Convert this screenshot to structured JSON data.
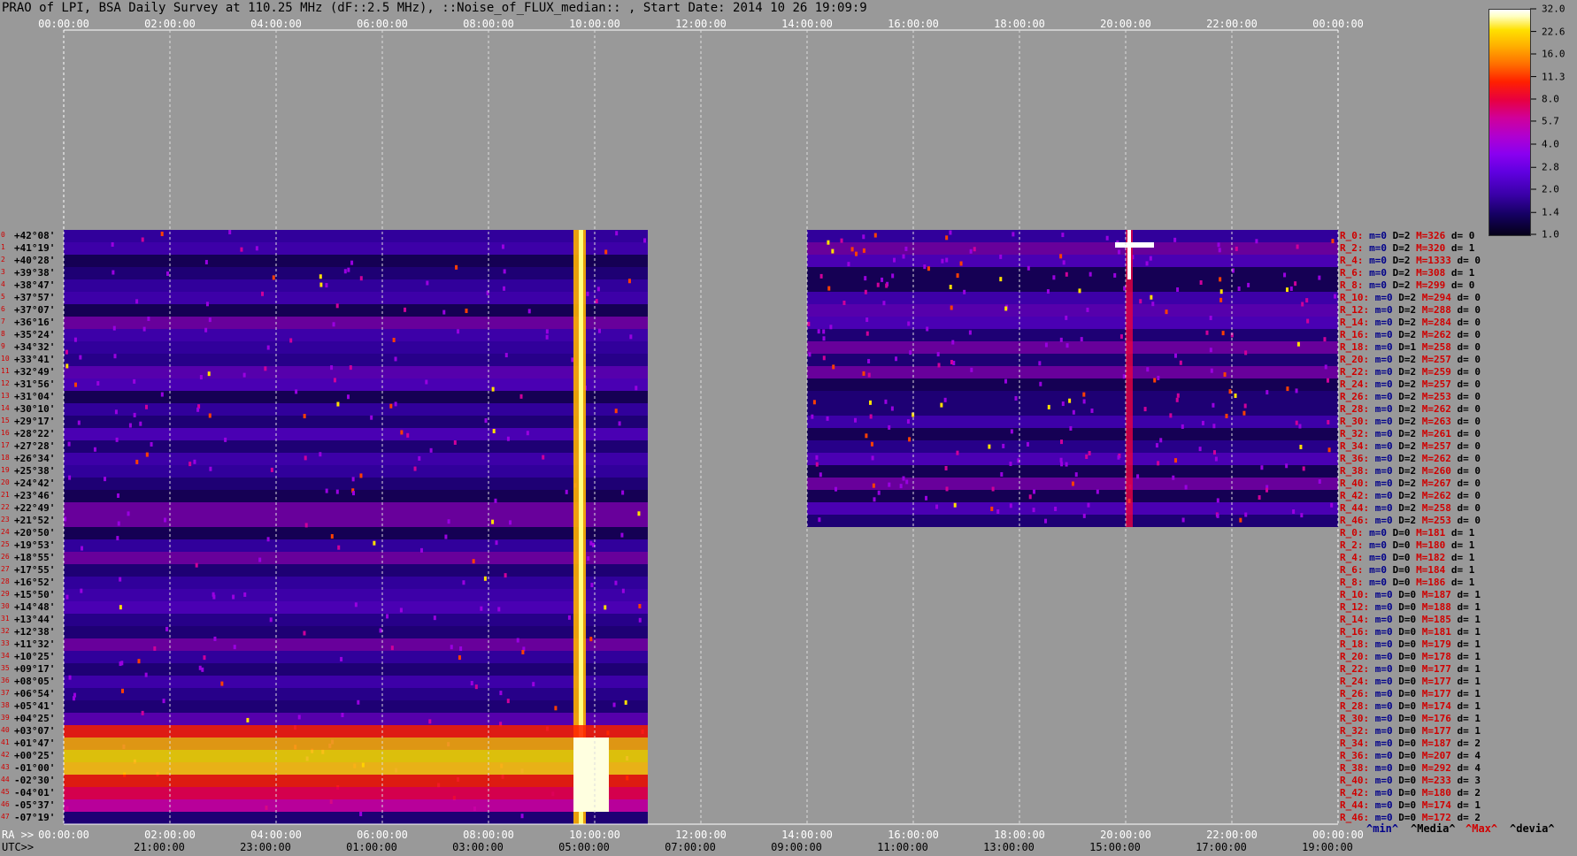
{
  "title": "PRAO of LPI, BSA Daily Survey at 110.25 MHz (dF::2.5 MHz), ::Noise_of_FLUX_median:: , Start Date: 2014 10 26 19:09:9",
  "colors": {
    "background": "#999999",
    "accent_red": "#d00000",
    "navy": "#00008a"
  },
  "axis": {
    "top_ticks": [
      "00:00:00",
      "02:00:00",
      "04:00:00",
      "06:00:00",
      "08:00:00",
      "10:00:00",
      "12:00:00",
      "14:00:00",
      "16:00:00",
      "18:00:00",
      "20:00:00",
      "22:00:00",
      "00:00:00"
    ],
    "bottom_ra_label": "RA >>",
    "bottom_ra_ticks": [
      "00:00:00",
      "02:00:00",
      "04:00:00",
      "06:00:00",
      "08:00:00",
      "10:00:00",
      "12:00:00",
      "14:00:00",
      "16:00:00",
      "18:00:00",
      "20:00:00",
      "22:00:00",
      "00:00:00"
    ],
    "bottom_utc_label": "UTC>>",
    "bottom_utc_ticks": [
      "21:00:00",
      "23:00:00",
      "01:00:00",
      "03:00:00",
      "05:00:00",
      "07:00:00",
      "09:00:00",
      "11:00:00",
      "13:00:00",
      "15:00:00",
      "17:00:00",
      "19:00:00"
    ]
  },
  "colorbar": {
    "labels": [
      "32.0",
      "22.6",
      "16.0",
      "11.3",
      "8.0",
      "5.7",
      "4.0",
      "2.8",
      "2.0",
      "1.4",
      "1.0"
    ]
  },
  "declinations": [
    "+42°08'",
    "+41°19'",
    "+40°28'",
    "+39°38'",
    "+38°47'",
    "+37°57'",
    "+37°07'",
    "+36°16'",
    "+35°24'",
    "+34°32'",
    "+33°41'",
    "+32°49'",
    "+31°56'",
    "+31°04'",
    "+30°10'",
    "+29°17'",
    "+28°22'",
    "+27°28'",
    "+26°34'",
    "+25°38'",
    "+24°42'",
    "+23°46'",
    "+22°49'",
    "+21°52'",
    "+20°50'",
    "+19°53'",
    "+18°55'",
    "+17°55'",
    "+16°52'",
    "+15°50'",
    "+14°48'",
    "+13°44'",
    "+12°38'",
    "+11°32'",
    "+10°25'",
    "+09°17'",
    "+08°05'",
    "+06°54'",
    "+05°41'",
    "+04°25'",
    "+03°07'",
    "+01°47'",
    "+00°25'",
    "-01°00'",
    "-02°30'",
    "-04°01'",
    "-05°37'",
    "-07°19'"
  ],
  "row_stats": [
    {
      "r": "R_0:",
      "m": "m=0",
      "d": "D=2",
      "M": "M=326",
      "dev": "d= 0"
    },
    {
      "r": "R_2:",
      "m": "m=0",
      "d": "D=2",
      "M": "M=320",
      "dev": "d= 1"
    },
    {
      "r": "R_4:",
      "m": "m=0",
      "d": "D=2",
      "M": "M=1333",
      "dev": "d= 0"
    },
    {
      "r": "R_6:",
      "m": "m=0",
      "d": "D=2",
      "M": "M=308",
      "dev": "d= 1"
    },
    {
      "r": "R_8:",
      "m": "m=0",
      "d": "D=2",
      "M": "M=299",
      "dev": "d= 0"
    },
    {
      "r": "R_10:",
      "m": "m=0",
      "d": "D=2",
      "M": "M=294",
      "dev": "d= 0"
    },
    {
      "r": "R_12:",
      "m": "m=0",
      "d": "D=2",
      "M": "M=288",
      "dev": "d= 0"
    },
    {
      "r": "R_14:",
      "m": "m=0",
      "d": "D=2",
      "M": "M=284",
      "dev": "d= 0"
    },
    {
      "r": "R_16:",
      "m": "m=0",
      "d": "D=2",
      "M": "M=262",
      "dev": "d= 0"
    },
    {
      "r": "R_18:",
      "m": "m=0",
      "d": "D=1",
      "M": "M=258",
      "dev": "d= 0"
    },
    {
      "r": "R_20:",
      "m": "m=0",
      "d": "D=2",
      "M": "M=257",
      "dev": "d= 0"
    },
    {
      "r": "R_22:",
      "m": "m=0",
      "d": "D=2",
      "M": "M=259",
      "dev": "d= 0"
    },
    {
      "r": "R_24:",
      "m": "m=0",
      "d": "D=2",
      "M": "M=257",
      "dev": "d= 0"
    },
    {
      "r": "R_26:",
      "m": "m=0",
      "d": "D=2",
      "M": "M=253",
      "dev": "d= 0"
    },
    {
      "r": "R_28:",
      "m": "m=0",
      "d": "D=2",
      "M": "M=262",
      "dev": "d= 0"
    },
    {
      "r": "R_30:",
      "m": "m=0",
      "d": "D=2",
      "M": "M=263",
      "dev": "d= 0"
    },
    {
      "r": "R_32:",
      "m": "m=0",
      "d": "D=2",
      "M": "M=261",
      "dev": "d= 0"
    },
    {
      "r": "R_34:",
      "m": "m=0",
      "d": "D=2",
      "M": "M=257",
      "dev": "d= 0"
    },
    {
      "r": "R_36:",
      "m": "m=0",
      "d": "D=2",
      "M": "M=262",
      "dev": "d= 0"
    },
    {
      "r": "R_38:",
      "m": "m=0",
      "d": "D=2",
      "M": "M=260",
      "dev": "d= 0"
    },
    {
      "r": "R_40:",
      "m": "m=0",
      "d": "D=2",
      "M": "M=267",
      "dev": "d= 0"
    },
    {
      "r": "R_42:",
      "m": "m=0",
      "d": "D=2",
      "M": "M=262",
      "dev": "d= 0"
    },
    {
      "r": "R_44:",
      "m": "m=0",
      "d": "D=2",
      "M": "M=258",
      "dev": "d= 0"
    },
    {
      "r": "R_46:",
      "m": "m=0",
      "d": "D=2",
      "M": "M=253",
      "dev": "d= 0"
    },
    {
      "r": "R_0:",
      "m": "m=0",
      "d": "D=0",
      "M": "M=181",
      "dev": "d= 1"
    },
    {
      "r": "R_2:",
      "m": "m=0",
      "d": "D=0",
      "M": "M=180",
      "dev": "d= 1"
    },
    {
      "r": "R_4:",
      "m": "m=0",
      "d": "D=0",
      "M": "M=182",
      "dev": "d= 1"
    },
    {
      "r": "R_6:",
      "m": "m=0",
      "d": "D=0",
      "M": "M=184",
      "dev": "d= 1"
    },
    {
      "r": "R_8:",
      "m": "m=0",
      "d": "D=0",
      "M": "M=186",
      "dev": "d= 1"
    },
    {
      "r": "R_10:",
      "m": "m=0",
      "d": "D=0",
      "M": "M=187",
      "dev": "d= 1"
    },
    {
      "r": "R_12:",
      "m": "m=0",
      "d": "D=0",
      "M": "M=188",
      "dev": "d= 1"
    },
    {
      "r": "R_14:",
      "m": "m=0",
      "d": "D=0",
      "M": "M=185",
      "dev": "d= 1"
    },
    {
      "r": "R_16:",
      "m": "m=0",
      "d": "D=0",
      "M": "M=181",
      "dev": "d= 1"
    },
    {
      "r": "R_18:",
      "m": "m=0",
      "d": "D=0",
      "M": "M=179",
      "dev": "d= 1"
    },
    {
      "r": "R_20:",
      "m": "m=0",
      "d": "D=0",
      "M": "M=178",
      "dev": "d= 1"
    },
    {
      "r": "R_22:",
      "m": "m=0",
      "d": "D=0",
      "M": "M=177",
      "dev": "d= 1"
    },
    {
      "r": "R_24:",
      "m": "m=0",
      "d": "D=0",
      "M": "M=177",
      "dev": "d= 1"
    },
    {
      "r": "R_26:",
      "m": "m=0",
      "d": "D=0",
      "M": "M=177",
      "dev": "d= 1"
    },
    {
      "r": "R_28:",
      "m": "m=0",
      "d": "D=0",
      "M": "M=174",
      "dev": "d= 1"
    },
    {
      "r": "R_30:",
      "m": "m=0",
      "d": "D=0",
      "M": "M=176",
      "dev": "d= 1"
    },
    {
      "r": "R_32:",
      "m": "m=0",
      "d": "D=0",
      "M": "M=177",
      "dev": "d= 1"
    },
    {
      "r": "R_34:",
      "m": "m=0",
      "d": "D=0",
      "M": "M=187",
      "dev": "d= 2"
    },
    {
      "r": "R_36:",
      "m": "m=0",
      "d": "D=0",
      "M": "M=207",
      "dev": "d= 4"
    },
    {
      "r": "R_38:",
      "m": "m=0",
      "d": "D=0",
      "M": "M=292",
      "dev": "d= 4"
    },
    {
      "r": "R_40:",
      "m": "m=0",
      "d": "D=0",
      "M": "M=233",
      "dev": "d= 3"
    },
    {
      "r": "R_42:",
      "m": "m=0",
      "d": "D=0",
      "M": "M=180",
      "dev": "d= 2"
    },
    {
      "r": "R_44:",
      "m": "m=0",
      "d": "D=0",
      "M": "M=174",
      "dev": "d= 1"
    },
    {
      "r": "R_46:",
      "m": "m=0",
      "d": "D=0",
      "M": "M=172",
      "dev": "d= 2"
    }
  ],
  "footer": {
    "min": "^min^",
    "median": "^Media^",
    "max": "^Max^",
    "deviation": "^devia^"
  },
  "chart_data": {
    "type": "heatmap",
    "title": "PRAO of LPI, BSA Daily Survey at 110.25 MHz (dF::2.5 MHz), ::Noise_of_FLUX_median:: , Start Date: 2014 10 26 19:09:9",
    "xlabel": "RA >> / UTC>>",
    "ylabel": "",
    "x_range": [
      "00:00:00",
      "24:00:00"
    ],
    "y_range": [
      "+42°08'",
      "-07°19'"
    ],
    "color_scale": {
      "min": 1.0,
      "max": 32.0,
      "log": true
    },
    "data_segments": [
      {
        "ra_from": "00:00:00",
        "ra_to": "11:00:00",
        "dec_from": "+42°08'",
        "dec_to": "-07°19'"
      },
      {
        "ra_from": "14:00:00",
        "ra_to": "24:00:00",
        "dec_from": "+42°08'",
        "dec_to": "+21°52'"
      }
    ],
    "grid": true
  }
}
